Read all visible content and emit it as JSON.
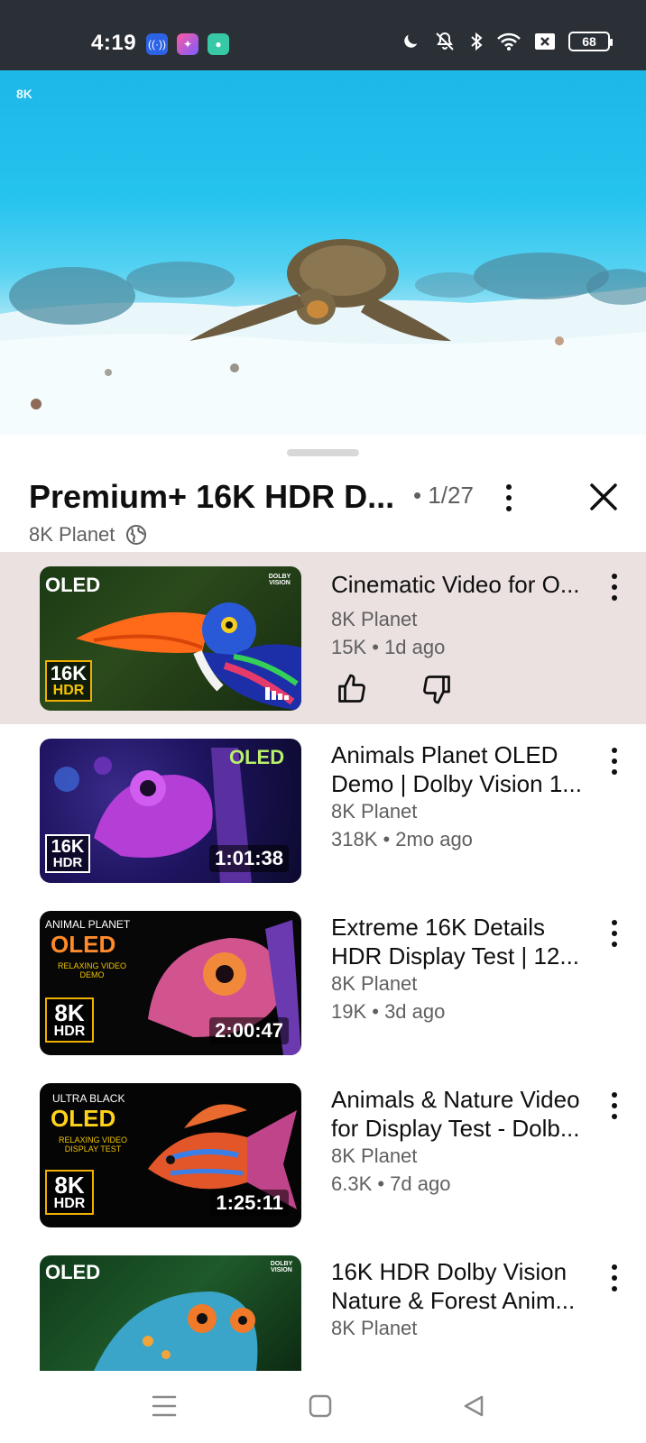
{
  "status_bar": {
    "time": "4:19",
    "battery": "68",
    "icons": [
      "hotspot-icon",
      "shortcut-icon",
      "chat-icon",
      "moon-icon",
      "mute-icon",
      "bluetooth-icon",
      "wifi-icon",
      "no-sim-icon",
      "battery-icon"
    ]
  },
  "player": {
    "badge": "8K"
  },
  "playlist": {
    "title": "Premium+ 16K HDR D...",
    "position": "• 1/27",
    "channel": "8K Planet"
  },
  "videos": [
    {
      "title": "Cinematic Video for O...",
      "channel": "8K Planet",
      "meta": "15K • 1d ago",
      "duration": "",
      "badge_top": "OLED",
      "badge_big": "16K",
      "badge_small": "HDR"
    },
    {
      "title": "Animals Planet OLED Demo | Dolby Vision 1...",
      "channel": "8K Planet",
      "meta": "318K • 2mo ago",
      "duration": "1:01:38",
      "badge_top": "OLED",
      "badge_big": "16K",
      "badge_small": "HDR"
    },
    {
      "title": "Extreme 16K Details HDR Display Test | 12...",
      "channel": "8K Planet",
      "meta": "19K • 3d ago",
      "duration": "2:00:47",
      "badge_top": "OLED",
      "badge_big": "8K",
      "badge_small": "HDR"
    },
    {
      "title": "Animals & Nature Video for Display Test - Dolb...",
      "channel": "8K Planet",
      "meta": "6.3K • 7d ago",
      "duration": "1:25:11",
      "badge_top": "OLED",
      "badge_big": "8K",
      "badge_small": "HDR"
    },
    {
      "title": "16K HDR Dolby Vision Nature & Forest Anim...",
      "channel": "8K Planet",
      "meta": "",
      "duration": "",
      "badge_top": "OLED",
      "badge_big": "",
      "badge_small": ""
    }
  ],
  "thumb_texts": {
    "animal_planet": "ANIMAL PLANET",
    "ultra_black": "ULTRA BLACK",
    "relaxing_demo": "RELAXING VIDEO DEMO",
    "relaxing_display": "RELAXING VIDEO DISPLAY TEST",
    "dolby": "DOLBY VISION"
  },
  "colors": {
    "active_row": "#ebe1e0",
    "status_bar": "#2b2f36",
    "secondary_text": "#606060"
  }
}
